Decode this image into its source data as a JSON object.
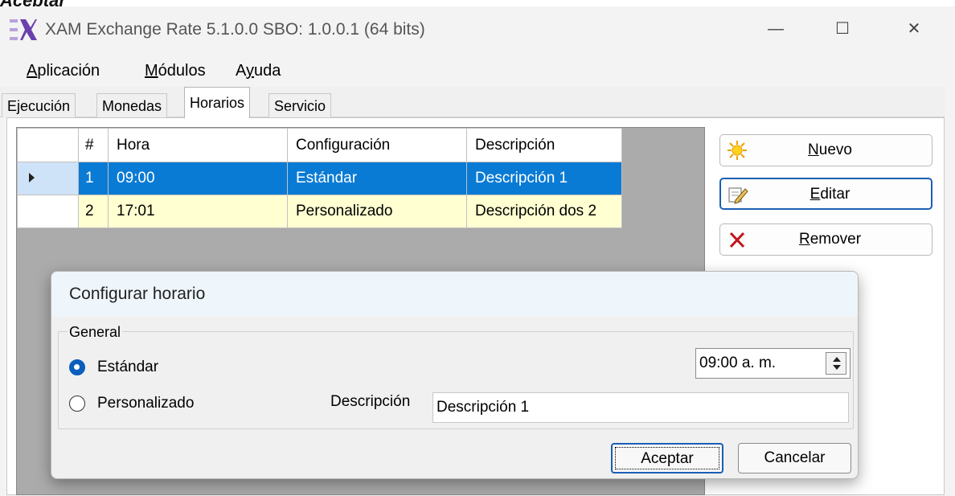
{
  "caption_text": "Aceptar",
  "window": {
    "title": "XAM Exchange Rate 5.1.0.0 SBO: 1.0.0.1 (64 bits)",
    "minimize_glyph": "—",
    "maximize_glyph": "☐",
    "close_glyph": "✕"
  },
  "menu": {
    "items": [
      {
        "underline": "A",
        "rest": "plicación"
      },
      {
        "underline": "M",
        "rest": "ódulos"
      },
      {
        "pre": "A",
        "underline": "y",
        "rest": "uda"
      }
    ]
  },
  "tabs": [
    "Ejecución",
    "Monedas",
    "Horarios",
    "Servicio"
  ],
  "active_tab": "Horarios",
  "grid": {
    "columns": [
      "#",
      "Hora",
      "Configuración",
      "Descripción"
    ],
    "rows": [
      {
        "num": "1",
        "hora": "09:00",
        "config": "Estándar",
        "desc": "Descripción 1",
        "selected": true
      },
      {
        "num": "2",
        "hora": "17:01",
        "config": "Personalizado",
        "desc": "Descripción dos 2",
        "selected": false
      }
    ]
  },
  "side_buttons": {
    "nuevo": "Nuevo",
    "editar": "Editar",
    "remover": "Remover"
  },
  "dialog": {
    "title": "Configurar horario",
    "group_label": "General",
    "radio_standard": "Estándar",
    "radio_custom": "Personalizado",
    "selected_radio": "Estándar",
    "time_value": "09:00 a. m.",
    "description_label": "Descripción",
    "description_value": "Descripción 1",
    "accept_label": "Aceptar",
    "cancel_label": "Cancelar"
  },
  "colors": {
    "selection_blue": "#0a7bd4",
    "alt_row_yellow": "#ffffd2",
    "focus_border": "#1a5fb4"
  }
}
